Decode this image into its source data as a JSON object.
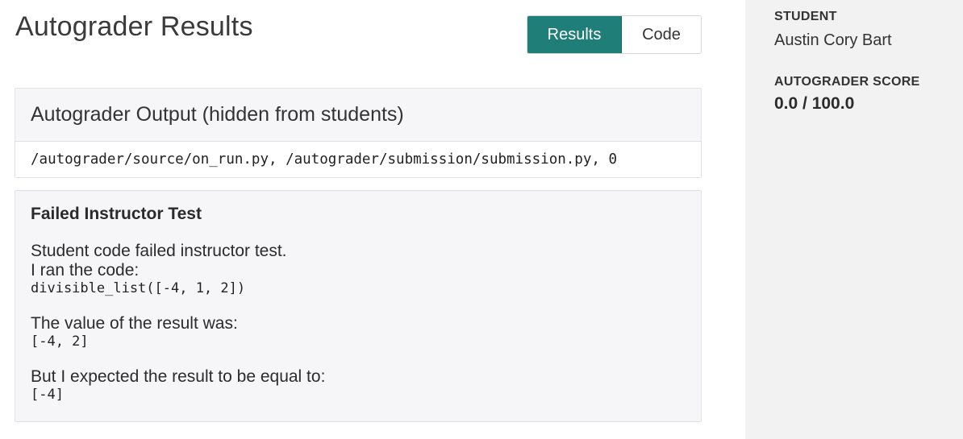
{
  "page": {
    "title": "Autograder Results"
  },
  "tabs": [
    {
      "label": "Results",
      "active": true
    },
    {
      "label": "Code",
      "active": false
    }
  ],
  "output_panel": {
    "title": "Autograder Output (hidden from students)",
    "body": "/autograder/source/on_run.py, /autograder/submission/submission.py, 0"
  },
  "test_panel": {
    "title": "Failed Instructor Test",
    "line1": "Student code failed instructor test.",
    "line2": "I ran the code:",
    "code": "divisible_list([-4, 1, 2])",
    "result_label": "The value of the result was:",
    "result_value": "[-4, 2]",
    "expected_label": "But I expected the result to be equal to:",
    "expected_value": "[-4]"
  },
  "sidebar": {
    "student_label": "STUDENT",
    "student_name": "Austin Cory Bart",
    "score_label": "AUTOGRADER SCORE",
    "score_value": "0.0 / 100.0"
  },
  "colors": {
    "accent": "#1f7f78",
    "sidebar_bg": "#f2f2f3",
    "panel_bg": "#f6f6f8"
  }
}
